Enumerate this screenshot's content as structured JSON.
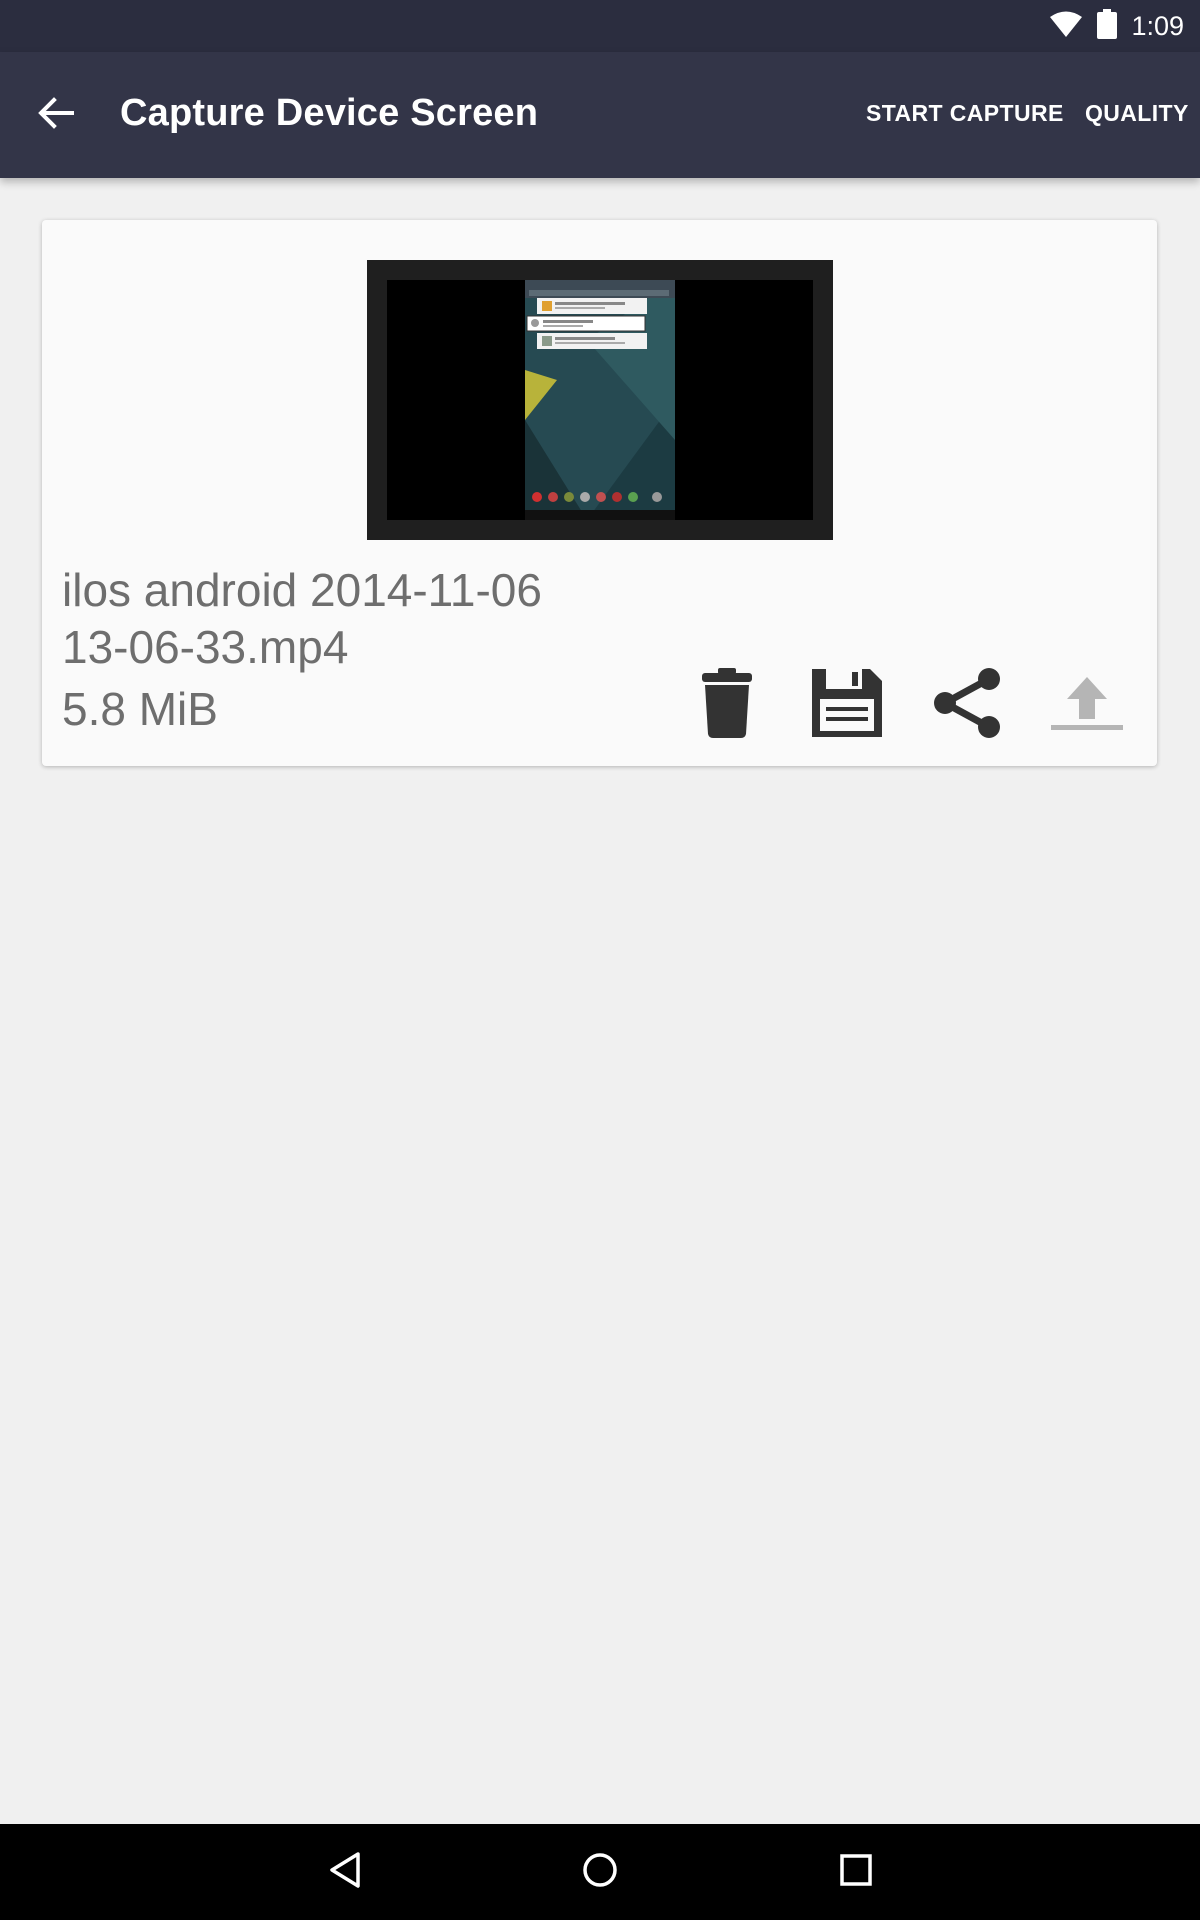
{
  "status_bar": {
    "time": "1:09",
    "icons": [
      "wifi-icon",
      "battery-icon"
    ]
  },
  "app_bar": {
    "title": "Capture Device Screen",
    "actions": {
      "start_capture": "START CAPTURE",
      "quality": "QUALITY"
    },
    "back_icon": "arrow-back-icon"
  },
  "recording": {
    "file_name_line1": "ilos android 2014-11-06",
    "file_name_line2": "13-06-33.mp4",
    "size": "5.8 MiB",
    "actions": [
      "delete-icon",
      "save-icon",
      "share-icon",
      "upload-icon"
    ]
  },
  "nav_bar": {
    "icons": [
      "nav-back-icon",
      "nav-home-icon",
      "nav-recents-icon"
    ]
  },
  "colors": {
    "status_bar": "#2b2d3f",
    "app_bar": "#333548",
    "background": "#f0f0f0",
    "card": "#fafafa",
    "icon_dark": "#333333",
    "icon_disabled": "#b5b5b5"
  }
}
